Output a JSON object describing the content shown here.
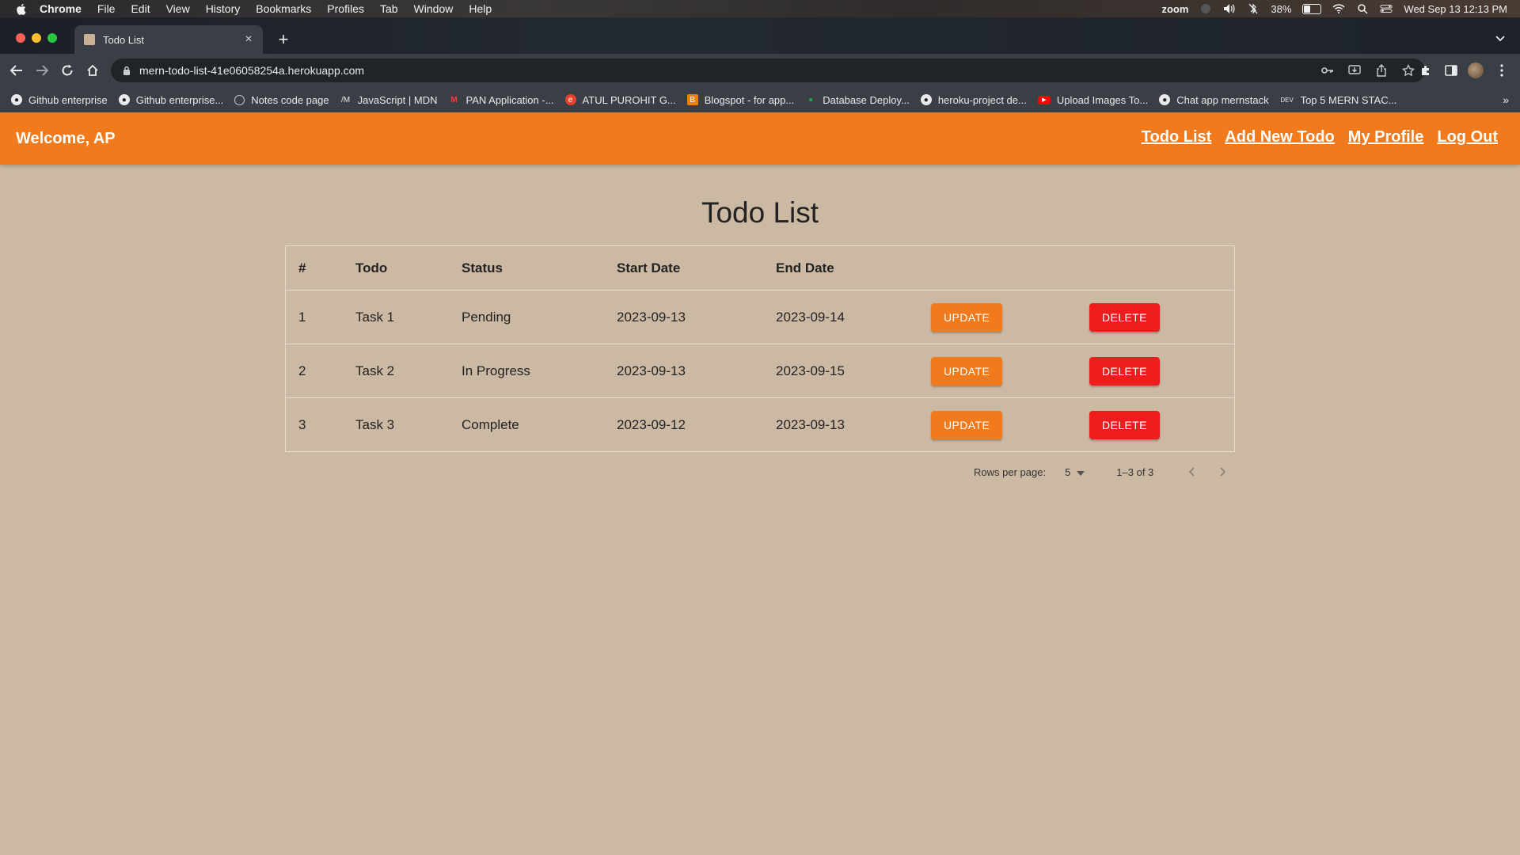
{
  "menubar": {
    "app": "Chrome",
    "items": [
      "File",
      "Edit",
      "View",
      "History",
      "Bookmarks",
      "Profiles",
      "Tab",
      "Window",
      "Help"
    ],
    "zoom_label": "zoom",
    "battery_percent": "38%",
    "battery_level": 0.38,
    "datetime": "Wed Sep 13  12:13 PM"
  },
  "browser": {
    "tab_title": "Todo List",
    "url": "mern-todo-list-41e06058254a.herokuapp.com"
  },
  "bookmarks": [
    {
      "label": "Github enterprise",
      "icon": "github-icon"
    },
    {
      "label": "Github enterprise...",
      "icon": "github-icon"
    },
    {
      "label": "Notes code page",
      "icon": "globe-icon"
    },
    {
      "label": "JavaScript | MDN",
      "icon": "mdn-icon"
    },
    {
      "label": "PAN Application -...",
      "icon": "gmail-icon"
    },
    {
      "label": "ATUL PUROHIT G...",
      "icon": "edge-icon"
    },
    {
      "label": "Blogspot - for app...",
      "icon": "blogger-icon"
    },
    {
      "label": "Database Deploy...",
      "icon": "mongodb-icon"
    },
    {
      "label": "heroku-project de...",
      "icon": "github-icon"
    },
    {
      "label": "Upload Images To...",
      "icon": "youtube-icon"
    },
    {
      "label": "Chat app mernstack",
      "icon": "github-icon"
    },
    {
      "label": "Top 5 MERN STAC...",
      "icon": "dev-icon"
    }
  ],
  "app": {
    "welcome": "Welcome, AP",
    "nav": [
      "Todo List",
      "Add New Todo",
      "My Profile",
      "Log Out"
    ],
    "title": "Todo List",
    "table": {
      "headers": [
        "#",
        "Todo",
        "Status",
        "Start Date",
        "End Date"
      ],
      "rows": [
        {
          "num": "1",
          "todo": "Task 1",
          "status": "Pending",
          "start": "2023-09-13",
          "end": "2023-09-14"
        },
        {
          "num": "2",
          "todo": "Task 2",
          "status": "In Progress",
          "start": "2023-09-13",
          "end": "2023-09-15"
        },
        {
          "num": "3",
          "todo": "Task 3",
          "status": "Complete",
          "start": "2023-09-12",
          "end": "2023-09-13"
        }
      ],
      "update_label": "UPDATE",
      "delete_label": "DELETE"
    },
    "pagination": {
      "rows_per_page_label": "Rows per page:",
      "rows_per_page_value": "5",
      "range": "1–3 of 3"
    }
  },
  "colors": {
    "accent": "#f07a1c",
    "danger": "#ee1c1c",
    "background": "#ccb9a3"
  }
}
